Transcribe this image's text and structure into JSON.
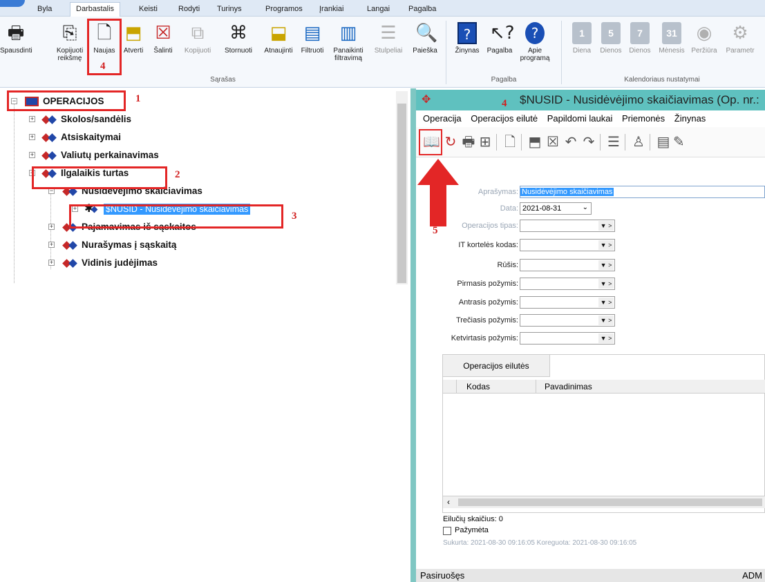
{
  "menu": {
    "tabs": [
      "Byla",
      "Darbastalis",
      "Keisti",
      "Rodyti",
      "Turinys",
      "Programos",
      "Įrankiai",
      "Langai",
      "Pagalba"
    ],
    "active_tab": "Darbastalis"
  },
  "ribbon": {
    "buttons": {
      "print": "Spausdinti",
      "copy_value": "Kopijuoti reikšmę",
      "new": "Naujas",
      "open": "Atverti",
      "delete": "Šalinti",
      "copy": "Kopijuoti",
      "reverse": "Stornuoti",
      "refresh": "Atnaujinti",
      "filter": "Filtruoti",
      "clear_filter": "Panaikinti filtravimą",
      "columns": "Stulpeliai",
      "search": "Paieška",
      "guide": "Žinynas",
      "help": "Pagalba",
      "about": "Apie programą",
      "day": "Diena",
      "days5": "Dienos",
      "days7": "Dienos",
      "month": "Mėnesis",
      "overview": "Peržiūra",
      "params": "Parametr"
    },
    "calendar_icons": {
      "day": "1",
      "days5": "5",
      "days7": "7",
      "month": "31"
    },
    "groups": {
      "list": "Sąrašas",
      "help": "Pagalba",
      "calendar": "Kalendoriaus nustatymai"
    }
  },
  "annotations": {
    "n1": "1",
    "n2": "2",
    "n3": "3",
    "n4a": "4",
    "n4b": "4",
    "n5": "5"
  },
  "tree": {
    "root": "OPERACIJOS",
    "items": [
      "Skolos/sandėlis",
      "Atsiskaitymai",
      "Valiutų perkainavimas",
      "Ilgalaikis turtas",
      "Nusidėvėjimo skaičiavimas",
      "$NUSID - Nusidėvėjimo skaičiavimas",
      "Pajamavimas iš sąskaitos",
      "Nurašymas į sąskaitą",
      "Vidinis judėjimas"
    ]
  },
  "window": {
    "title": "$NUSID - Nusidėvėjimo skaičiavimas (Op. nr.:",
    "menu": [
      "Operacija",
      "Operacijos eilutė",
      "Papildomi laukai",
      "Priemonės",
      "Žinynas"
    ]
  },
  "form": {
    "labels": {
      "description": "Aprašymas:",
      "date": "Data:",
      "op_type": "Operacijos tipas:",
      "it_card": "IT kortelės kodas:",
      "kind": "Rūšis:",
      "attr1": "Pirmasis požymis:",
      "attr2": "Antrasis požymis:",
      "attr3": "Trečiasis požymis:",
      "attr4": "Ketvirtasis požymis:"
    },
    "description_value": "Nusidėvėjimo skaičiavimas",
    "date_value": "2021-08-31",
    "combo_arrow": "▼ >"
  },
  "grid": {
    "tab": "Operacijos eilutės",
    "col_code": "Kodas",
    "col_name": "Pavadinimas",
    "row_count": "Eilučių skaičius: 0",
    "marked": "Pažymėta",
    "audit": "Sukurta: 2021-08-30 09:16:05 Koreguota: 2021-08-30 09:16:05"
  },
  "status": {
    "left": "Pasiruošęs",
    "right": "ADM"
  },
  "colors": {
    "accent": "#5fc1bf",
    "annotation": "#e32626",
    "selection": "#3399ff"
  }
}
